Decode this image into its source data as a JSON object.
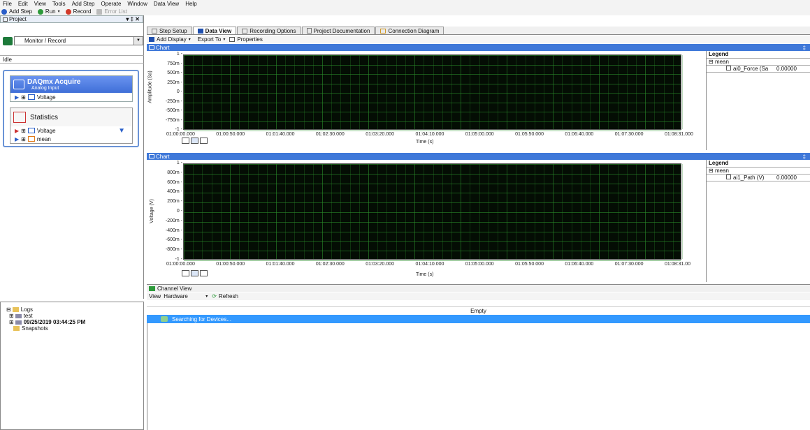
{
  "menu": [
    "File",
    "Edit",
    "View",
    "Tools",
    "Add Step",
    "Operate",
    "Window",
    "Data View",
    "Help"
  ],
  "toolbar": {
    "add_step": "Add Step",
    "run": "Run",
    "record": "Record",
    "error_list": "Error List"
  },
  "project_panel": {
    "title": "Project",
    "pin": "▾ ‡ ✕",
    "mode": "Monitor / Record",
    "status": "Idle",
    "steps": [
      {
        "name": "DAQmx Acquire",
        "sub": "Analog Input",
        "child": "Voltage"
      },
      {
        "name": "Statistics",
        "child1": "Voltage",
        "child2": "mean"
      }
    ]
  },
  "tabs": [
    "Step Setup",
    "Data View",
    "Recording Options",
    "Project Documentation",
    "Connection Diagram"
  ],
  "dataview_toolbar": {
    "add_display": "Add Display",
    "export_to": "Export To",
    "properties": "Properties"
  },
  "charts": [
    {
      "title": "Chart",
      "ylabel": "Amplitude (Sa)",
      "yticks": [
        "1",
        "750m",
        "500m",
        "250m",
        "0",
        "-250m",
        "-500m",
        "-750m",
        "-1"
      ],
      "xticks": [
        "01:00:00.000",
        "01:00:50.000",
        "01:01:40.000",
        "01:02:30.000",
        "01:03:20.000",
        "01:04:10.000",
        "01:05:00.000",
        "01:05:50.000",
        "01:06:40.000",
        "01:07:30.000",
        "01:08:31.000"
      ],
      "xlabel": "Time (s)",
      "legend": {
        "title": "Legend",
        "group": "mean",
        "channel": "ai0_Force (Sa",
        "value": "0.00000"
      }
    },
    {
      "title": "Chart",
      "ylabel": "Voltage (V)",
      "yticks": [
        "1",
        "800m",
        "600m",
        "400m",
        "200m",
        "0",
        "-200m",
        "-400m",
        "-600m",
        "-800m",
        "-1"
      ],
      "xticks": [
        "01:00:00.000",
        "01:00:50.000",
        "01:01:40.000",
        "01:02:30.000",
        "01:03:20.000",
        "01:04:10.000",
        "01:05:00.000",
        "01:05:50.000",
        "01:06:40.000",
        "01:07:30.000",
        "01:08:31.00"
      ],
      "xlabel": "Time (s)",
      "legend": {
        "title": "Legend",
        "group": "mean",
        "channel": "ai1_Path (V)",
        "value": "0.00000"
      }
    }
  ],
  "channel_view": {
    "title": "Channel View",
    "view_label": "View",
    "view_value": "Hardware",
    "refresh": "Refresh",
    "empty": "Empty",
    "searching": "Searching for Devices..."
  },
  "logs": {
    "root": "Logs",
    "items": [
      "test",
      "09/25/2019 03:44:25 PM",
      "Snapshots"
    ]
  },
  "colors": {
    "accent": "#3f78d9",
    "selection": "#3399ff",
    "plot_bg": "#040d04",
    "grid": "#2a8a2a"
  }
}
